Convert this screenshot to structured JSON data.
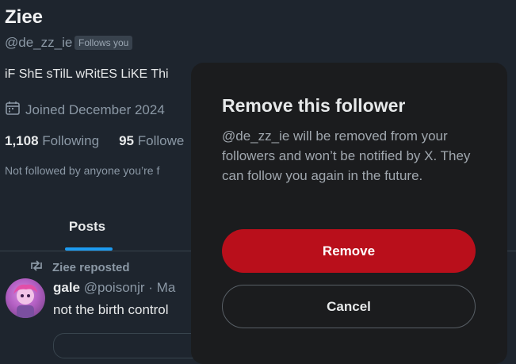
{
  "profile": {
    "display_name": "Ziee",
    "handle": "@de_zz_ie",
    "follows_you_badge": "Follows you",
    "bio": "iF ShE sTilL wRitES LiKE Thi",
    "joined": "Joined December 2024",
    "stats": {
      "following_count": "1,108",
      "following_label": "Following",
      "followers_count": "95",
      "followers_label": "Followe"
    },
    "not_followed_text": "Not followed by anyone you’re f"
  },
  "tabs": {
    "posts_label": "Posts",
    "active_color": "#1d9bf0"
  },
  "post": {
    "repost_label": "Ziee reposted",
    "author_name": "gale",
    "author_meta": "@poisonjr · Ma",
    "text": "not the birth control"
  },
  "modal": {
    "title": "Remove this follower",
    "body": "@de_zz_ie will be removed from your followers and won’t be notified by X. They can follow you again in the future.",
    "remove_label": "Remove",
    "cancel_label": "Cancel",
    "remove_color": "#b90f1b"
  },
  "icons": {
    "calendar": "calendar-icon",
    "repost": "repost-icon"
  }
}
